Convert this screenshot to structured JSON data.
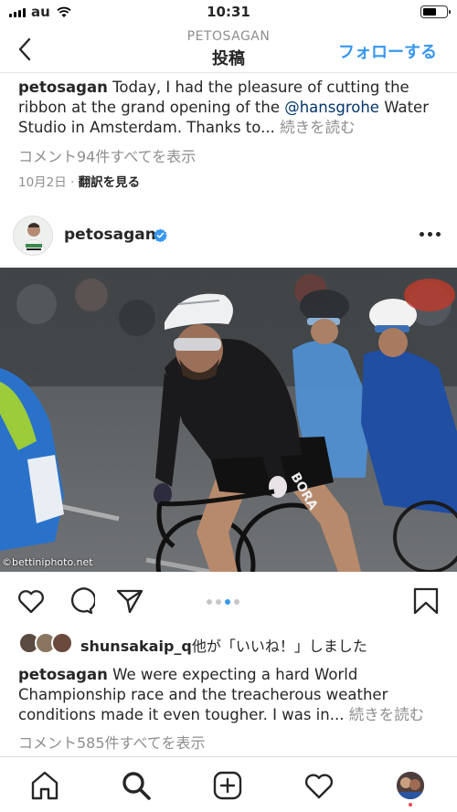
{
  "status_bar": {
    "carrier": "au",
    "time": "10:31",
    "battery_level": 0.6
  },
  "nav": {
    "subtitle": "PETOSAGAN",
    "title": "投稿",
    "follow_label": "フォローする"
  },
  "prev_post": {
    "username": "petosagan",
    "caption_part1": " Today, I had the pleasure of cutting the ribbon at the grand opening of the ",
    "mention": "@hansgrohe",
    "caption_part2": " Water Studio in Amsterdam. Thanks to...",
    "more_label": " 続きを読む",
    "comments_label": "コメント94件すべてを表示",
    "date": "10月2日",
    "separator": " · ",
    "translate_label": "翻訳を見る"
  },
  "post": {
    "username": "petosagan",
    "photo_credit": "©bettiniphoto.net",
    "carousel_dots": 4,
    "carousel_active_index": 2,
    "likes_user": "shunsakaip_q",
    "likes_suffix": "他が「いいね！」しました",
    "caption_user": "petosagan",
    "caption_text": " We were expecting a hard World Championship race and the treacherous weather conditions made it even tougher. I was in...",
    "more_label": " 続きを読む",
    "comments_label": "コメント585件すべてを表示"
  },
  "colors": {
    "accent": "#3897f0",
    "mention": "#003569",
    "muted": "#8e8e8e",
    "notification_dot": "#ed4956"
  },
  "icons": {
    "back": "chevron-left-icon",
    "verified": "verified-badge-icon",
    "more": "more-options-icon",
    "like": "heart-icon",
    "comment": "comment-icon",
    "share": "paper-plane-icon",
    "save": "bookmark-icon",
    "tabs": [
      "home-icon",
      "search-icon",
      "add-icon",
      "heart-icon",
      "profile-icon"
    ]
  }
}
